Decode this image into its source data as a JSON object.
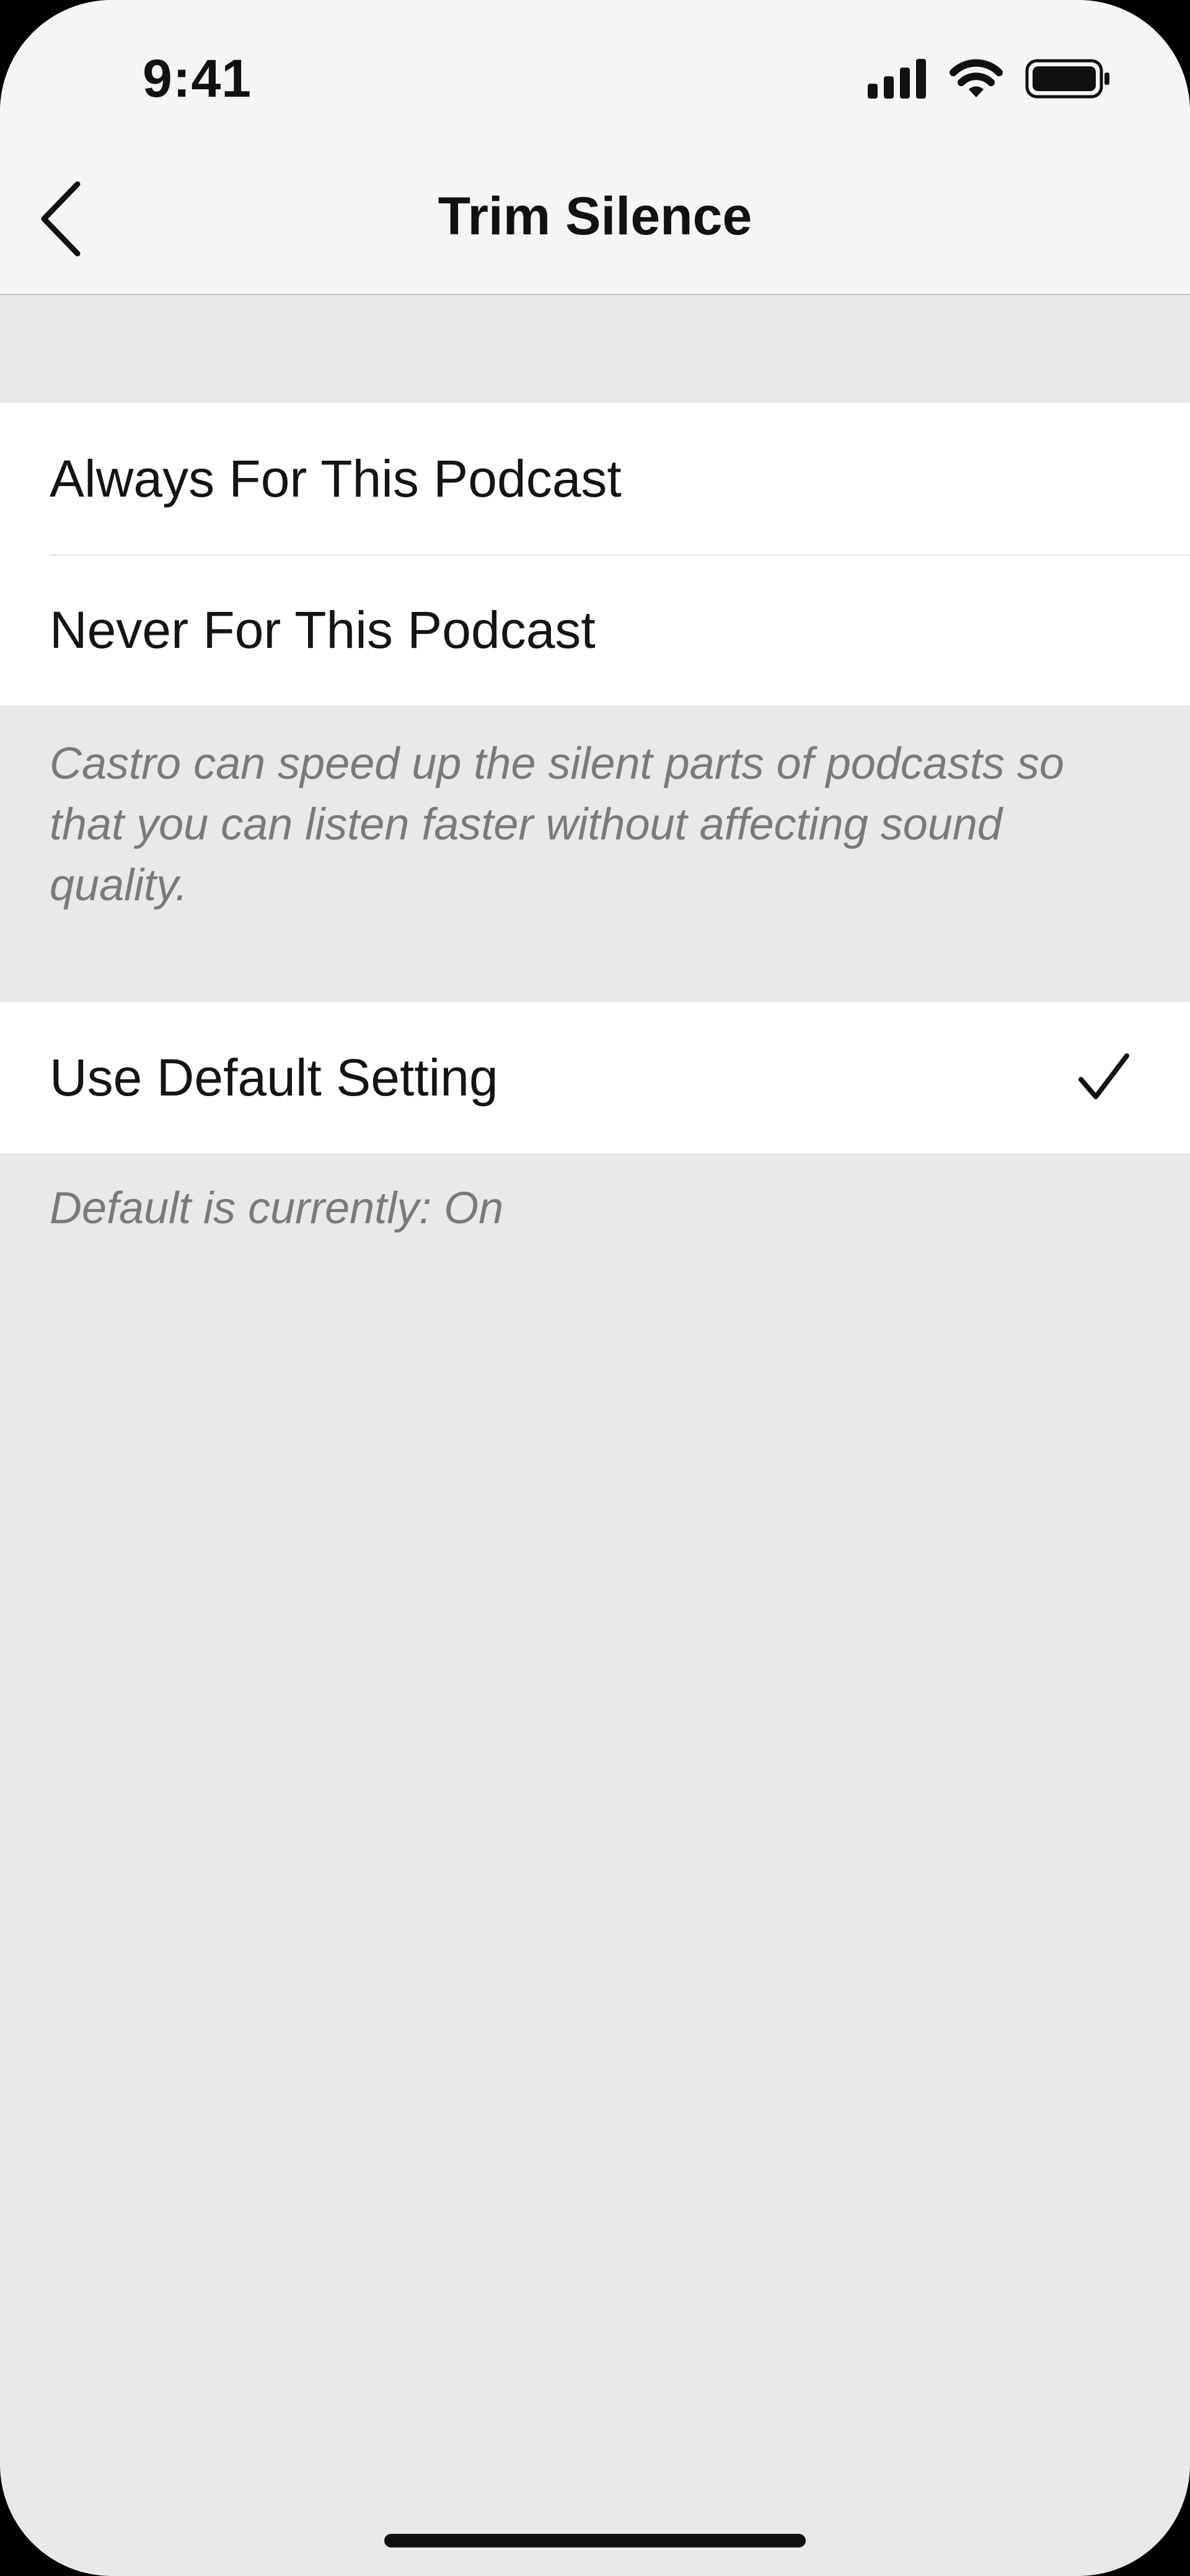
{
  "status_bar": {
    "time": "9:41",
    "icons": [
      "cellular-signal-icon",
      "wifi-icon",
      "battery-icon"
    ]
  },
  "nav": {
    "back_icon": "chevron-left-icon",
    "title": "Trim Silence"
  },
  "options_group": {
    "items": [
      {
        "label": "Always For This Podcast"
      },
      {
        "label": "Never For This Podcast"
      }
    ],
    "footnote": "Castro can speed up the silent parts of podcasts so that you can listen faster without affecting sound quality."
  },
  "default_group": {
    "items": [
      {
        "label": "Use Default Setting",
        "selected": true,
        "icon": "checkmark-icon"
      }
    ],
    "footnote": "Default is currently: On"
  },
  "colors": {
    "background": "#e9e9e9",
    "cell": "#ffffff",
    "text": "#141414",
    "secondary_text": "#7a7a7a",
    "nav_background": "#f5f5f5"
  }
}
